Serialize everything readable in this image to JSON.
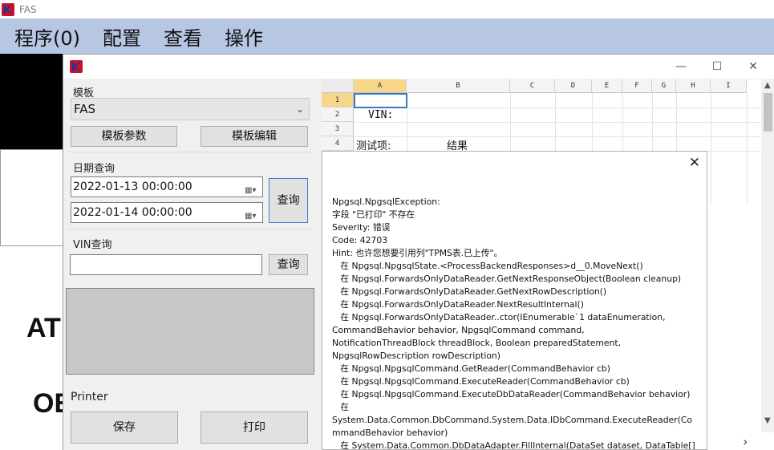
{
  "app": {
    "title": "FAS"
  },
  "menu": {
    "items": [
      "程序(0)",
      "配置",
      "查看",
      "操作"
    ]
  },
  "background": {
    "text_at": "AT",
    "text_ob": "OE"
  },
  "dialog": {
    "template_group_label": "模板",
    "template_value": "FAS",
    "template_params_button": "模板参数",
    "template_edit_button": "模板编辑",
    "date_group_label": "日期查询",
    "date_start": "2022-01-13 00:00:00",
    "date_end": "2022-01-14 00:00:00",
    "date_query_button": "查询",
    "vin_group_label": "VIN查询",
    "vin_value": "",
    "vin_query_button": "查询",
    "printer_label": "Printer",
    "save_button": "保存",
    "print_button": "打印",
    "minimize_glyph": "—",
    "maximize_glyph": "☐",
    "close_glyph": "✕"
  },
  "sheet": {
    "columns": [
      "A",
      "B",
      "C",
      "D",
      "E",
      "F",
      "G",
      "H",
      "I"
    ],
    "rows": [
      "1",
      "2",
      "3",
      "4"
    ],
    "cells": {
      "A2": "VIN:",
      "A4": "测试项:",
      "B4": "结果"
    }
  },
  "error": {
    "close_glyph": "✕",
    "message": "Npgsql.NpgsqlException:\n字段 \"已打印\" 不存在\nSeverity: 错误\nCode: 42703\nHint: 也许您想要引用列\"TPMS表.已上传\"。\n   在 Npgsql.NpgsqlState.<ProcessBackendResponses>d__0.MoveNext()\n   在 Npgsql.ForwardsOnlyDataReader.GetNextResponseObject(Boolean cleanup)\n   在 Npgsql.ForwardsOnlyDataReader.GetNextRowDescription()\n   在 Npgsql.ForwardsOnlyDataReader.NextResultInternal()\n   在 Npgsql.ForwardsOnlyDataReader..ctor(IEnumerable`1 dataEnumeration,\nCommandBehavior behavior, NpgsqlCommand command,\nNotificationThreadBlock threadBlock, Boolean preparedStatement,\nNpgsqlRowDescription rowDescription)\n   在 Npgsql.NpgsqlCommand.GetReader(CommandBehavior cb)\n   在 Npgsql.NpgsqlCommand.ExecuteReader(CommandBehavior cb)\n   在 Npgsql.NpgsqlCommand.ExecuteDbDataReader(CommandBehavior behavior)\n   在\nSystem.Data.Common.DbCommand.System.Data.IDbCommand.ExecuteReader(Co\nmmandBehavior behavior)\n   在 System.Data.Common.DbDataAdapter.FillInternal(DataSet dataset, DataTable[]"
  }
}
